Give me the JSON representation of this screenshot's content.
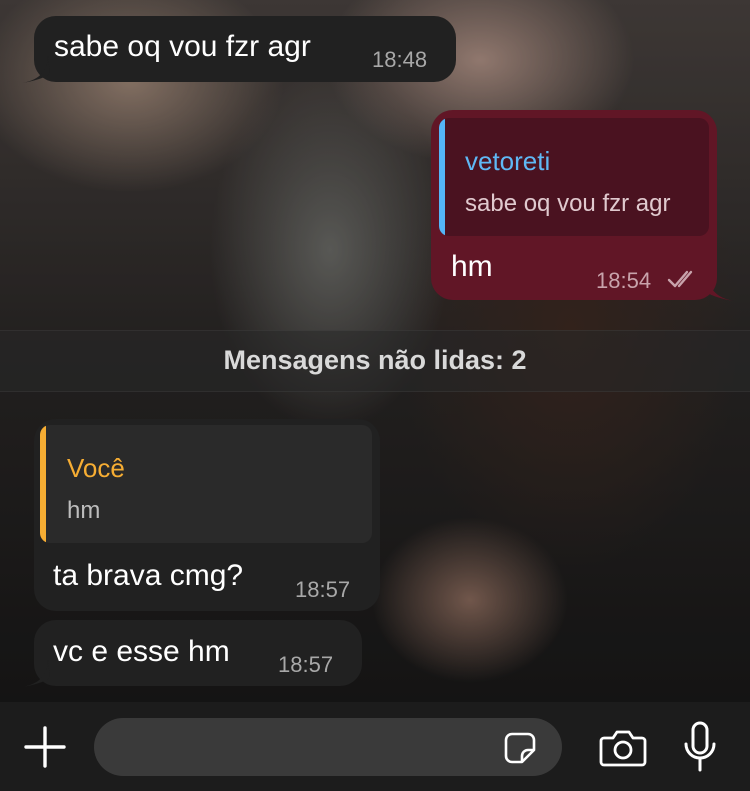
{
  "colors": {
    "incoming_bubble": "#212121",
    "outgoing_bubble": "#611626",
    "reply_bar_blue": "#54b5f7",
    "reply_name_blue": "#5fb8f5",
    "reply_bar_orange": "#f6ad33",
    "reply_name_orange": "#f6ad33",
    "input_background": "#3a3a3a"
  },
  "messages": [
    {
      "direction": "incoming",
      "text": "sabe oq vou fzr agr",
      "time": "18:48"
    },
    {
      "direction": "outgoing",
      "reply_to": {
        "name": "vetoreti",
        "text": "sabe oq vou fzr agr"
      },
      "text": "hm",
      "time": "18:54",
      "status_icon": "double-check-icon"
    },
    {
      "direction": "incoming",
      "reply_to": {
        "name": "Você",
        "text": "hm"
      },
      "text": "ta brava cmg?",
      "time": "18:57"
    },
    {
      "direction": "incoming",
      "text": "vc e esse hm",
      "time": "18:57"
    }
  ],
  "unread_banner": {
    "label": "Mensagens não lidas: 2"
  },
  "input_bar": {
    "placeholder": "",
    "icons": [
      "plus-icon",
      "sticker-icon",
      "camera-icon",
      "microphone-icon"
    ]
  }
}
